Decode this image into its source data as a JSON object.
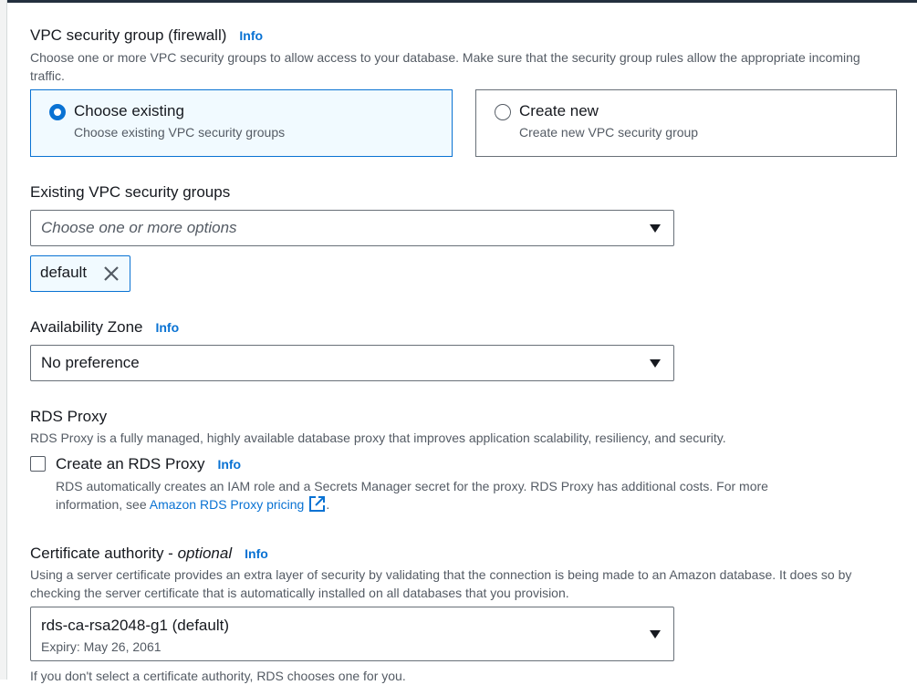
{
  "vpc": {
    "label": "VPC security group (firewall)",
    "info": "Info",
    "description": "Choose one or more VPC security groups to allow access to your database. Make sure that the security group rules allow the appropriate incoming traffic.",
    "options": [
      {
        "title": "Choose existing",
        "subtitle": "Choose existing VPC security groups",
        "selected": true
      },
      {
        "title": "Create new",
        "subtitle": "Create new VPC security group",
        "selected": false
      }
    ]
  },
  "existing_groups": {
    "label": "Existing VPC security groups",
    "placeholder": "Choose one or more options",
    "tokens": [
      "default"
    ]
  },
  "availability_zone": {
    "label": "Availability Zone",
    "info": "Info",
    "value": "No preference"
  },
  "rds_proxy": {
    "label": "RDS Proxy",
    "description": "RDS Proxy is a fully managed, highly available database proxy that improves application scalability, resiliency, and security.",
    "checkbox_label": "Create an RDS Proxy",
    "info": "Info",
    "checked": false,
    "detail_line1": "RDS automatically creates an IAM role and a Secrets Manager secret for the proxy. RDS Proxy has additional costs. For more",
    "detail_line2_prefix": "information, see ",
    "pricing_link": "Amazon RDS Proxy pricing",
    "detail_line2_suffix": "."
  },
  "certificate": {
    "label": "Certificate authority - ",
    "optional": "optional",
    "info": "Info",
    "description": "Using a server certificate provides an extra layer of security by validating that the connection is being made to an Amazon database. It does so by checking the server certificate that is automatically installed on all databases that you provision.",
    "value": "rds-ca-rsa2048-g1 (default)",
    "expiry": "Expiry: May 26, 2061",
    "footer": "If you don't select a certificate authority, RDS chooses one for you."
  },
  "colors": {
    "accent": "#0972d3",
    "selected_bg": "#f1faff",
    "text": "#16191f",
    "secondary_text": "#545b64",
    "border": "#687078"
  }
}
